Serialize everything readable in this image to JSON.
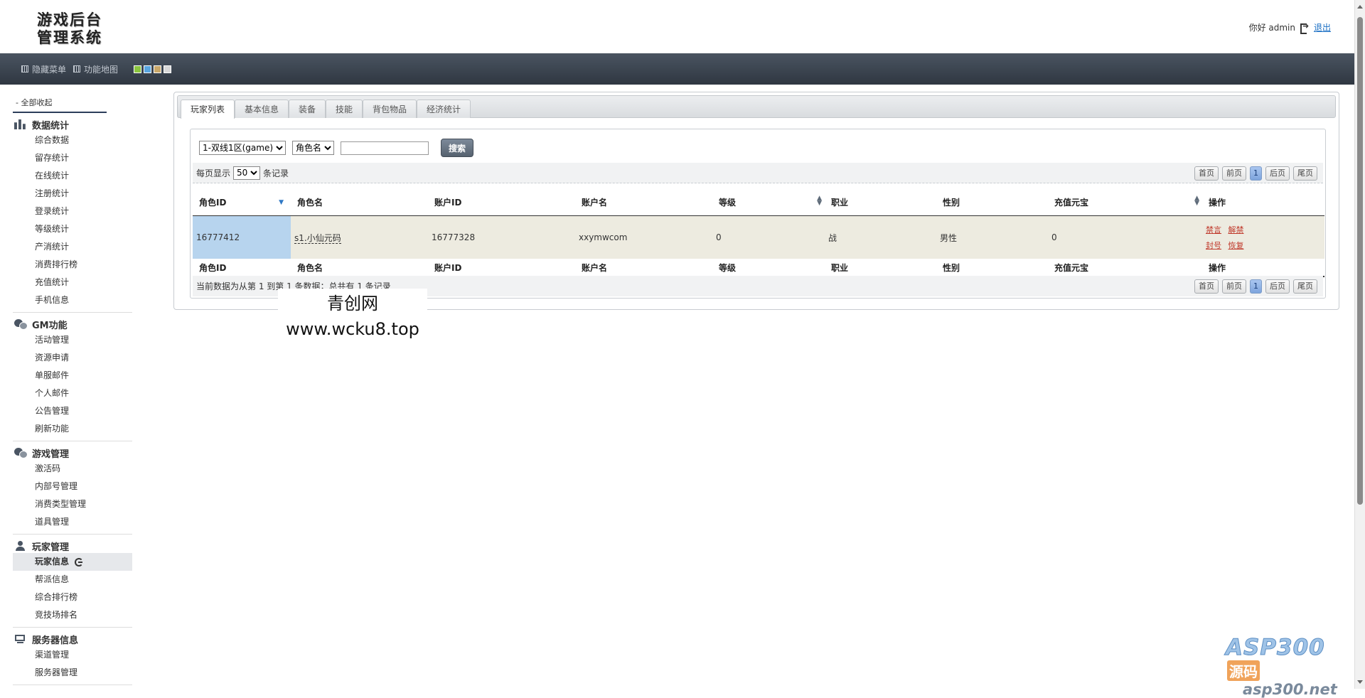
{
  "header": {
    "logo_line1": "游戏后台",
    "logo_line2": "管理系统",
    "greeting": "你好 admin",
    "logout": "退出"
  },
  "toolbar": {
    "hide_menu": "隐藏菜单",
    "func_map": "功能地图",
    "swatch_colors": [
      "#8bc53f",
      "#5aa6e0",
      "#c9a86a",
      "#d8d8d8"
    ]
  },
  "sidebar": {
    "collapse_all": "- 全部收起",
    "groups": [
      {
        "title": "数据统计",
        "icon": "bar-chart-icon",
        "items": [
          "综合数据",
          "留存统计",
          "在线统计",
          "注册统计",
          "登录统计",
          "等级统计",
          "产消统计",
          "消费排行榜",
          "充值统计",
          "手机信息"
        ]
      },
      {
        "title": "GM功能",
        "icon": "chat-bubbles-icon",
        "items": [
          "活动管理",
          "资源申请",
          "单服邮件",
          "个人邮件",
          "公告管理",
          "刷新功能"
        ]
      },
      {
        "title": "游戏管理",
        "icon": "chat-bubbles-icon",
        "items": [
          "激活码",
          "内部号管理",
          "消费类型管理",
          "道具管理"
        ]
      },
      {
        "title": "玩家管理",
        "icon": "person-icon",
        "items": [
          "玩家信息",
          "帮派信息",
          "综合排行榜",
          "竞技场排名"
        ]
      },
      {
        "title": "服务器信息",
        "icon": "server-icon",
        "items": [
          "渠道管理",
          "服务器管理"
        ]
      }
    ]
  },
  "tabs": [
    "玩家列表",
    "基本信息",
    "装备",
    "技能",
    "背包物品",
    "经济统计"
  ],
  "search": {
    "server_selected": "1-双线1区(game)",
    "field_selected": "角色名",
    "input_value": "",
    "button": "搜索"
  },
  "paging": {
    "per_page_prefix": "每页显示",
    "per_page_value": "50",
    "per_page_suffix": "条记录",
    "first": "首页",
    "prev": "前页",
    "current": "1",
    "next": "后页",
    "last": "尾页",
    "summary": "当前数据为从第 1 到第 1 条数据；总共有 1 条记录"
  },
  "table": {
    "columns": [
      "角色ID",
      "角色名",
      "账户ID",
      "账户名",
      "等级",
      "职业",
      "性别",
      "充值元宝",
      "操作"
    ],
    "rows": [
      {
        "role_id": "16777412",
        "role_name": "s1.小仙元码",
        "account_id": "16777328",
        "account_name": "xxymwcom",
        "level": "0",
        "job": "战",
        "gender": "男性",
        "recharge": "0",
        "ops": [
          "禁言",
          "解禁",
          "封号",
          "恢复"
        ]
      }
    ]
  },
  "watermarks": {
    "box_line1": "青创网",
    "box_line2": "www.wcku8.top",
    "asp_big": "ASP300",
    "asp_tag": "源码",
    "asp_url": "asp300.net"
  }
}
